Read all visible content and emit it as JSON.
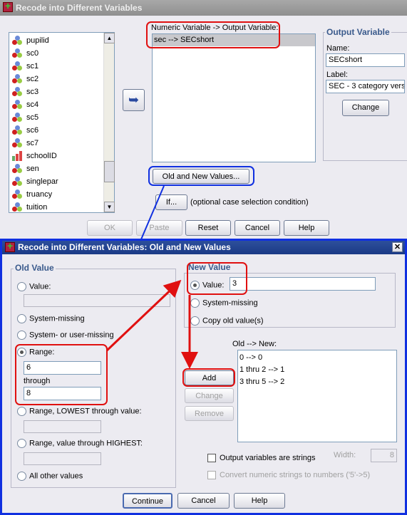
{
  "main_dialog": {
    "title": "Recode into Different Variables",
    "variables": [
      {
        "name": "pupilid",
        "type": "scale"
      },
      {
        "name": "sc0",
        "type": "scale"
      },
      {
        "name": "sc1",
        "type": "scale"
      },
      {
        "name": "sc2",
        "type": "scale"
      },
      {
        "name": "sc3",
        "type": "scale"
      },
      {
        "name": "sc4",
        "type": "scale"
      },
      {
        "name": "sc5",
        "type": "scale"
      },
      {
        "name": "sc6",
        "type": "scale"
      },
      {
        "name": "sc7",
        "type": "scale"
      },
      {
        "name": "schoolID",
        "type": "ordinal"
      },
      {
        "name": "sen",
        "type": "scale"
      },
      {
        "name": "singlepar",
        "type": "scale"
      },
      {
        "name": "truancy",
        "type": "scale"
      },
      {
        "name": "tuition",
        "type": "scale"
      }
    ],
    "mapping_label": "Numeric Variable -> Output Variable:",
    "mapping_items": [
      "sec --> SECshort"
    ],
    "output_variable": {
      "legend": "Output Variable",
      "name_label": "Name:",
      "name_value": "SECshort",
      "label_label": "Label:",
      "label_value": "SEC - 3 category vers",
      "change_label": "Change"
    },
    "old_new_button": "Old and New Values...",
    "if_button": "If...",
    "if_text": "(optional case selection condition)",
    "buttons": {
      "ok": "OK",
      "paste": "Paste",
      "reset": "Reset",
      "cancel": "Cancel",
      "help": "Help"
    }
  },
  "sub_dialog": {
    "title": "Recode into Different Variables: Old and New Values",
    "old_value": {
      "legend": "Old Value",
      "value_label": "Value:",
      "value_input": "",
      "system_missing": "System-missing",
      "sys_user_missing": "System- or user-missing",
      "range_label": "Range:",
      "range_from": "6",
      "through_label": "through",
      "range_to": "8",
      "range_lowest": "Range, LOWEST through value:",
      "range_highest": "Range, value through HIGHEST:",
      "all_other": "All other values",
      "selected": "range"
    },
    "new_value": {
      "legend": "New Value",
      "value_label": "Value:",
      "value_input": "3",
      "system_missing": "System-missing",
      "copy_old": "Copy old value(s)",
      "selected": "value"
    },
    "old_new_label": "Old --> New:",
    "old_new_items": [
      "0 --> 0",
      "1 thru 2 --> 1",
      "3 thru 5 --> 2"
    ],
    "add": "Add",
    "change": "Change",
    "remove": "Remove",
    "output_strings": "Output variables are strings",
    "width_label": "Width:",
    "width_value": "8",
    "convert": "Convert numeric strings to numbers ('5'->5)",
    "buttons": {
      "continue": "Continue",
      "cancel": "Cancel",
      "help": "Help"
    }
  },
  "colors": {
    "annotation_red": "#e01010",
    "annotation_blue": "#1030e0"
  }
}
